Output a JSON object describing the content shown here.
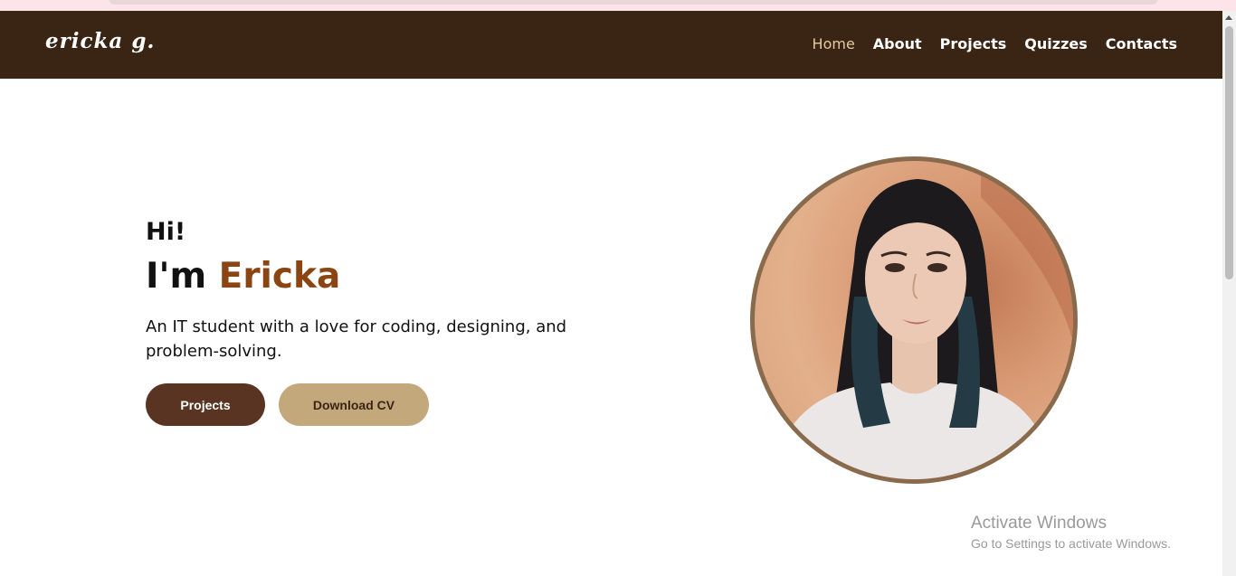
{
  "nav": {
    "logo": "ericka g.",
    "links": [
      "Home",
      "About",
      "Projects",
      "Quizzes",
      "Contacts"
    ],
    "active": "Home"
  },
  "hero": {
    "greeting": "Hi!",
    "intro_prefix": "I'm",
    "name": "Ericka",
    "tagline": "An IT student with a love for coding, designing, and problem-solving.",
    "buttons": {
      "primary": "Projects",
      "secondary": "Download CV"
    }
  },
  "watermark": {
    "title": "Activate Windows",
    "subtitle": "Go to Settings to activate Windows."
  },
  "colors": {
    "nav_bg": "#3a2414",
    "accent_name": "#8b4513",
    "button_primary": "#5a3422",
    "button_secondary": "#c3a87c",
    "nav_active": "#e5c9a3"
  }
}
